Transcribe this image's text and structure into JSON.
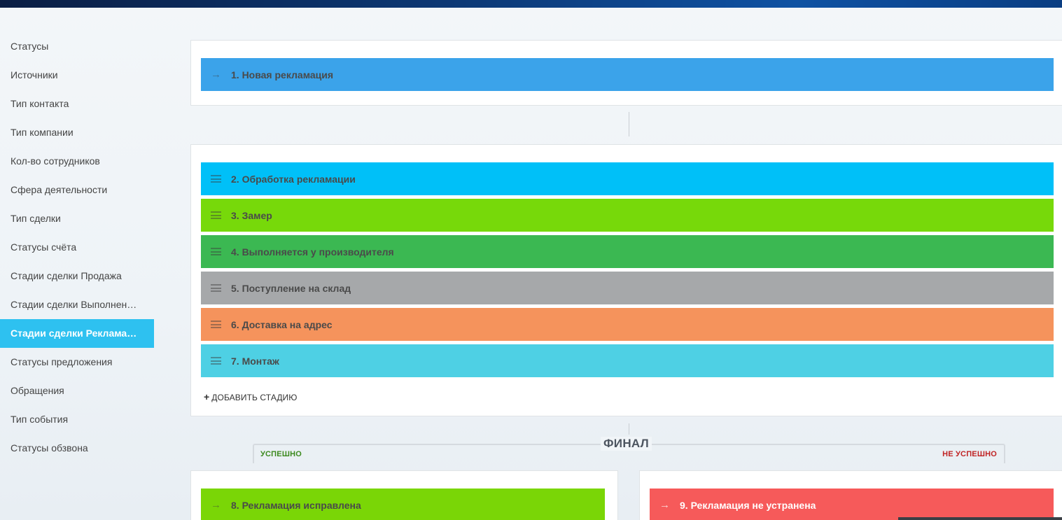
{
  "sidebar": {
    "items": [
      {
        "label": "Статусы"
      },
      {
        "label": "Источники"
      },
      {
        "label": "Тип контакта"
      },
      {
        "label": "Тип компании"
      },
      {
        "label": "Кол-во сотрудников"
      },
      {
        "label": "Сфера деятельности"
      },
      {
        "label": "Тип сделки"
      },
      {
        "label": "Статусы счёта"
      },
      {
        "label": "Стадии сделки Продажа"
      },
      {
        "label": "Стадии сделки Выполнен…"
      },
      {
        "label": "Стадии сделки Реклама…",
        "active": true
      },
      {
        "label": "Статусы предложения"
      },
      {
        "label": "Обращения"
      },
      {
        "label": "Тип события"
      },
      {
        "label": "Статусы обзвона"
      }
    ]
  },
  "initial_stage": {
    "label": "1. Новая рекламация",
    "color": "#3ba3ea"
  },
  "stages": [
    {
      "label": "2. Обработка рекламации",
      "color": "#00c0f8"
    },
    {
      "label": "3. Замер",
      "color": "#77d90a"
    },
    {
      "label": "4. Выполняется у производителя",
      "color": "#3bb852"
    },
    {
      "label": "5. Поступление на склад",
      "color": "#a6a8aa"
    },
    {
      "label": "6. Доставка на адрес",
      "color": "#f5935c"
    },
    {
      "label": "7. Монтаж",
      "color": "#4ed0e4"
    }
  ],
  "add_stage": {
    "plus": "+",
    "label": "ДОБАВИТЬ СТАДИЮ"
  },
  "final": {
    "title": "ФИНАЛ",
    "success_label": "УСПЕШНО",
    "fail_label": "НЕ УСПЕШНО",
    "success_stage": {
      "label": "8. Рекламация исправлена",
      "color": "#7ad606"
    },
    "fail_stage": {
      "label": "9. Рекламация не устранена",
      "color": "#f65a5a"
    }
  },
  "icons": {
    "drag": "drag-handle-icon",
    "arrow": "arrow-right-icon"
  }
}
